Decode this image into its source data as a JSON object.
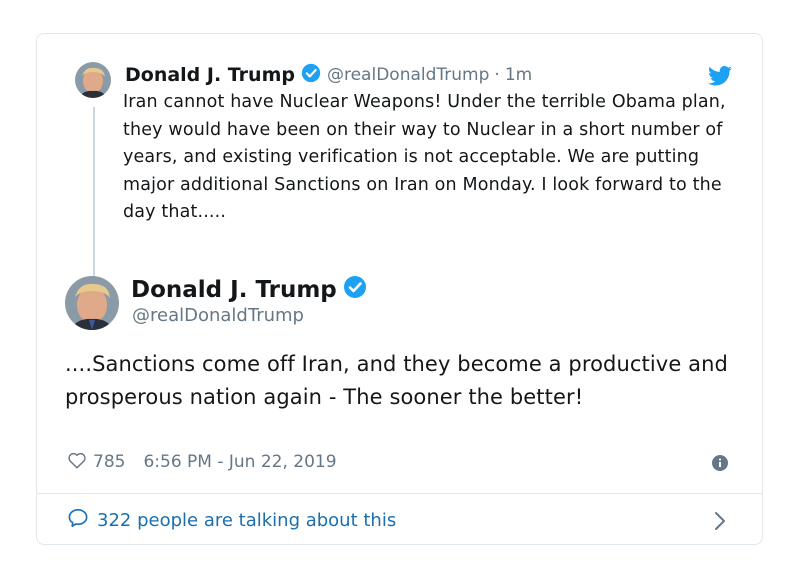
{
  "quoted": {
    "name": "Donald J. Trump",
    "handle": "@realDonaldTrump",
    "separator": "·",
    "time": "1m",
    "text": "Iran cannot have Nuclear Weapons! Under the terrible Obama plan, they would have been on their way to Nuclear in a short number of years, and existing verification is not acceptable. We are putting major additional Sanctions on Iran on Monday. I look forward to the day that....."
  },
  "main": {
    "name": "Donald J. Trump",
    "handle": "@realDonaldTrump",
    "text": "....Sanctions come off Iran, and they become a productive and prosperous nation again - The sooner the better!",
    "likes": "785",
    "timestamp": "6:56 PM - Jun 22, 2019"
  },
  "footer": {
    "text": "322 people are talking about this"
  },
  "colors": {
    "verified": "#1da1f2",
    "twitter_blue": "#1da1f2",
    "link": "#1b6fb0",
    "muted": "#657786"
  },
  "icons": [
    "verified-badge-icon",
    "twitter-bird-icon",
    "heart-icon",
    "info-icon",
    "speech-bubble-icon",
    "chevron-right-icon"
  ]
}
